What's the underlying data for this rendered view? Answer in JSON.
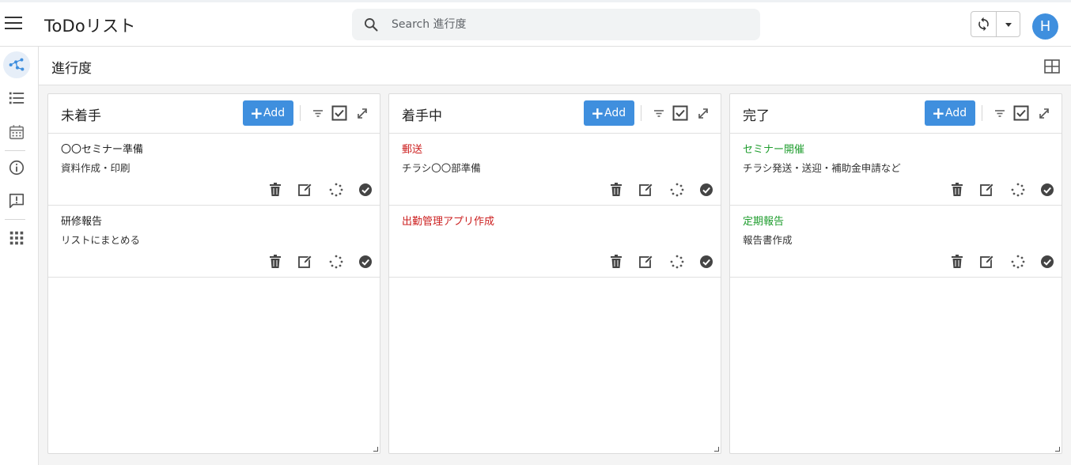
{
  "app": {
    "title": "ToDoリスト"
  },
  "search": {
    "placeholder": "Search 進行度"
  },
  "user": {
    "avatar_letter": "H",
    "avatar_color": "#3f8fde"
  },
  "page": {
    "title": "進行度"
  },
  "colors": {
    "accent": "#3f8fde",
    "in_progress": "#cc1f1f",
    "done": "#1f9d2e"
  },
  "columns": [
    {
      "title": "未着手",
      "add_label": "Add",
      "cards": [
        {
          "title": "〇〇セミナー準備",
          "desc": "資料作成・印刷"
        },
        {
          "title": "研修報告",
          "desc": "リストにまとめる"
        }
      ]
    },
    {
      "title": "着手中",
      "add_label": "Add",
      "cards": [
        {
          "title": "郵送",
          "desc": "チラシ〇〇部準備"
        },
        {
          "title": "出勤管理アプリ作成",
          "desc": ""
        }
      ]
    },
    {
      "title": "完了",
      "add_label": "Add",
      "cards": [
        {
          "title": "セミナー開催",
          "desc": "チラシ発送・送迎・補助金申請など"
        },
        {
          "title": "定期報告",
          "desc": "報告書作成"
        }
      ]
    }
  ]
}
